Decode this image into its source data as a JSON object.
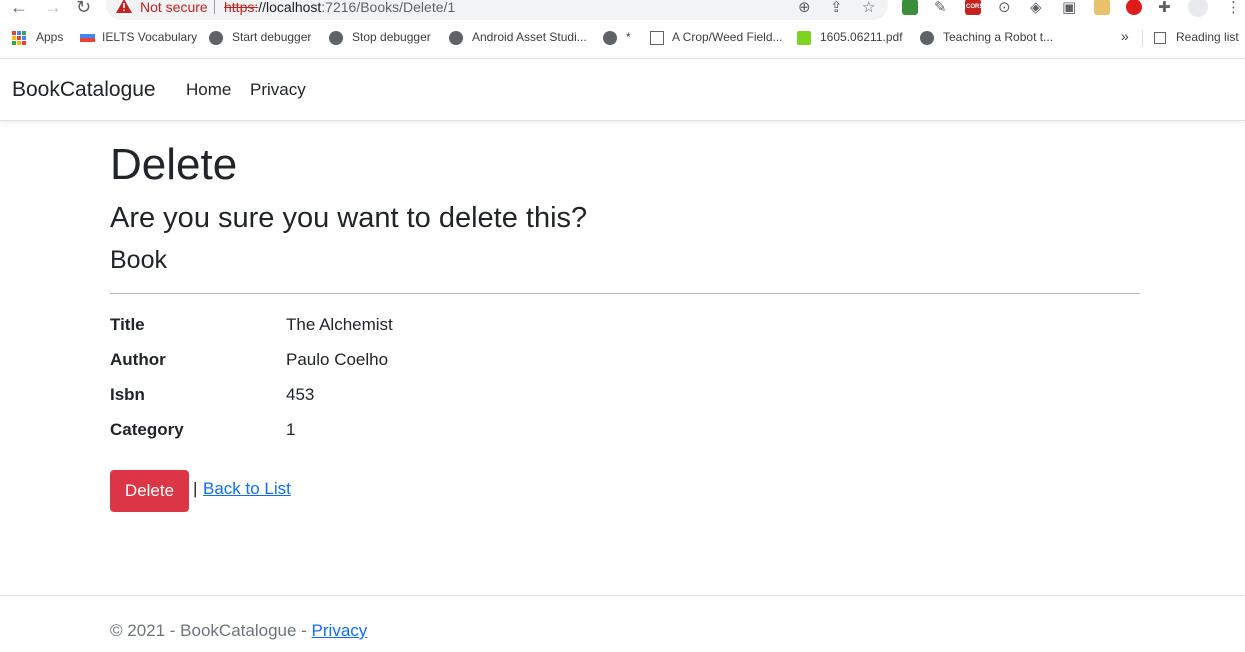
{
  "browser": {
    "security_label": "Not secure",
    "url_scheme": "https:",
    "url_host": "//localhost",
    "url_rest": ":7216/Books/Delete/1",
    "warning_color": "#c5221f",
    "extension_cors_label": "CORS"
  },
  "bookmarks": {
    "items": [
      {
        "label": "Apps",
        "icon": "apps-grid-icon"
      },
      {
        "label": "IELTS Vocabulary",
        "icon": "flag-icon"
      },
      {
        "label": "Start debugger",
        "icon": "globe-icon"
      },
      {
        "label": "Stop debugger",
        "icon": "globe-icon"
      },
      {
        "label": "Android Asset Studi...",
        "icon": "globe-icon"
      },
      {
        "label": "*",
        "icon": "globe-icon"
      },
      {
        "label": "A Crop/Weed Field...",
        "icon": "page-icon"
      },
      {
        "label": "1605.06211.pdf",
        "icon": "smiley-icon"
      },
      {
        "label": "Teaching a Robot t...",
        "icon": "globe-icon"
      }
    ],
    "overflow": "»",
    "reading_list": "Reading list"
  },
  "navbar": {
    "brand": "BookCatalogue",
    "links": [
      "Home",
      "Privacy"
    ]
  },
  "page": {
    "heading": "Delete",
    "question": "Are you sure you want to delete this?",
    "entity": "Book",
    "fields": [
      {
        "label": "Title",
        "value": "The Alchemist"
      },
      {
        "label": "Author",
        "value": "Paulo Coelho"
      },
      {
        "label": "Isbn",
        "value": "453"
      },
      {
        "label": "Category",
        "value": "1"
      }
    ],
    "delete_button": "Delete",
    "separator": "|",
    "back_link": "Back to List",
    "danger_color": "#dc3545",
    "link_color": "#0d6efd"
  },
  "footer": {
    "copyright": "© 2021 - BookCatalogue - ",
    "privacy_link": "Privacy"
  }
}
